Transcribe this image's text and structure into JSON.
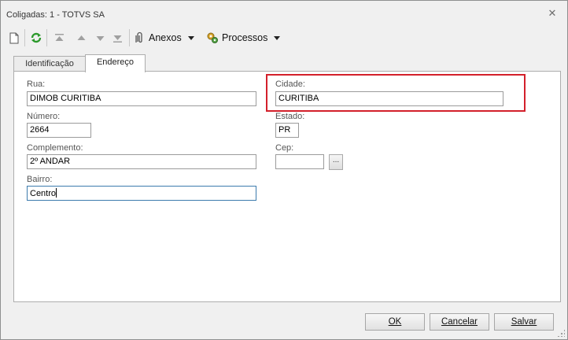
{
  "window": {
    "title": "Coligadas: 1 - TOTVS SA",
    "close_icon": "close-icon"
  },
  "toolbar": {
    "new_icon": "new-document-icon",
    "refresh_icon": "refresh-icon",
    "first_icon": "first-record-icon",
    "prev_icon": "previous-record-icon",
    "next_icon": "next-record-icon",
    "last_icon": "last-record-icon",
    "anexos_label": "Anexos",
    "processos_label": "Processos"
  },
  "tabs": [
    {
      "label": "Identificação",
      "active": false
    },
    {
      "label": "Endereço",
      "active": true
    }
  ],
  "form": {
    "rua": {
      "label": "Rua:",
      "value": "DIMOB CURITIBA"
    },
    "numero": {
      "label": "Número:",
      "value": "2664"
    },
    "complemento": {
      "label": "Complemento:",
      "value": "2º ANDAR"
    },
    "bairro": {
      "label": "Bairro:",
      "value": "Centro"
    },
    "cidade": {
      "label": "Cidade:",
      "value": "CURITIBA"
    },
    "estado": {
      "label": "Estado:",
      "value": "PR"
    },
    "cep": {
      "label": "Cep:",
      "value": ""
    },
    "lookup_label": "..."
  },
  "footer": {
    "ok_label": "OK",
    "cancel_label": "Cancelar",
    "save_label": "Salvar"
  },
  "colors": {
    "highlight": "#d3202b",
    "focus_border": "#3d7bad"
  }
}
